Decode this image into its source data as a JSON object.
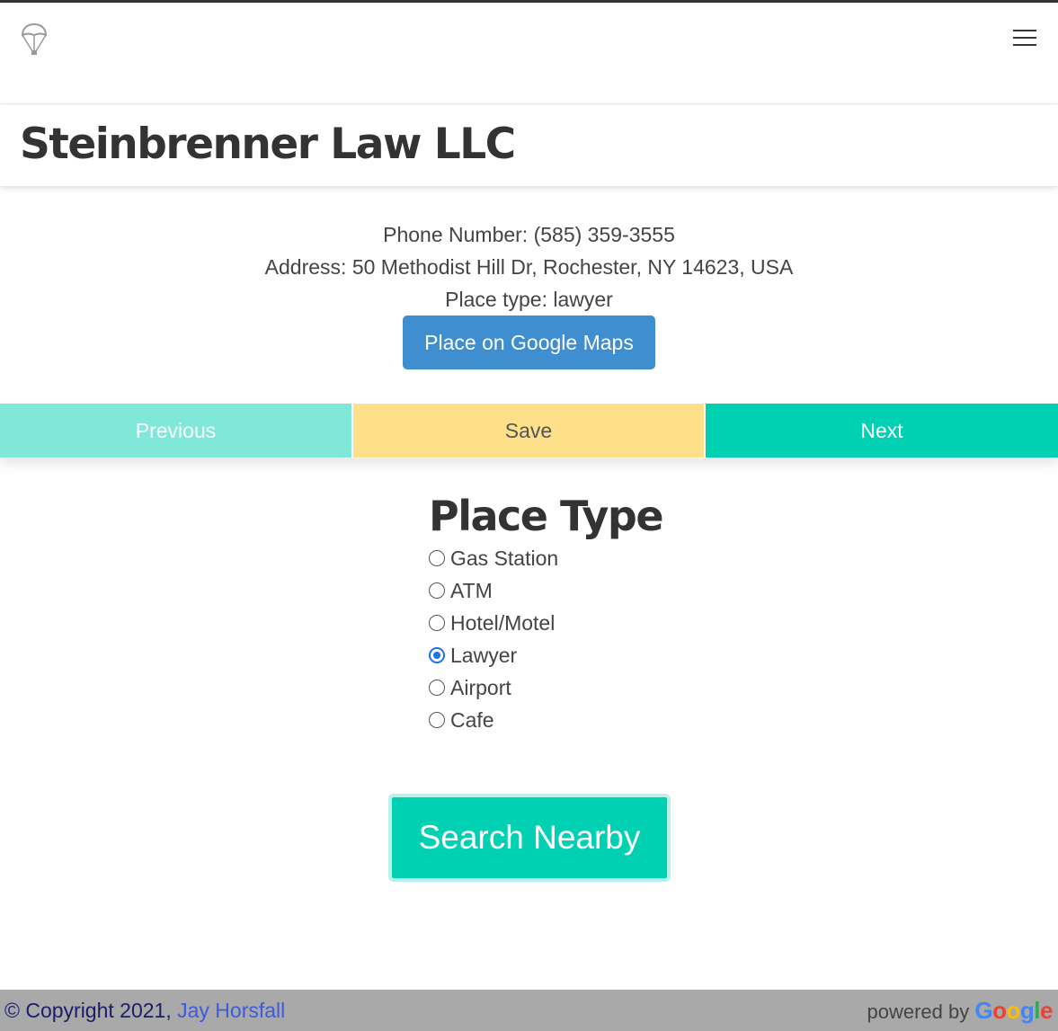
{
  "header": {
    "logo_icon": "parachute-icon",
    "menu_icon": "hamburger-menu-icon"
  },
  "place": {
    "name": "Steinbrenner Law LLC",
    "phone_line": "Phone Number: (585) 359-3555",
    "address_line": "Address: 50 Methodist Hill Dr, Rochester, NY 14623, USA",
    "type_line": "Place type: lawyer",
    "maps_button": "Place on Google Maps"
  },
  "nav": {
    "previous": "Previous",
    "save": "Save",
    "next": "Next"
  },
  "place_type": {
    "heading": "Place Type",
    "options": [
      {
        "label": "Gas Station",
        "checked": false
      },
      {
        "label": "ATM",
        "checked": false
      },
      {
        "label": "Hotel/Motel",
        "checked": false
      },
      {
        "label": "Lawyer",
        "checked": true
      },
      {
        "label": "Airport",
        "checked": false
      },
      {
        "label": "Cafe",
        "checked": false
      }
    ],
    "selected": "Lawyer"
  },
  "search_button": "Search Nearby",
  "footer": {
    "copyright_prefix": "© Copyright 2021, ",
    "author_link": "Jay Horsfall",
    "powered_by": "powered by",
    "google": "Google"
  },
  "colors": {
    "primary_teal": "#00d1b2",
    "light_teal": "#80e8d8",
    "save_yellow": "#fee08b",
    "maps_blue": "#3e8ed0",
    "footer_gray": "#a9a9a9"
  }
}
